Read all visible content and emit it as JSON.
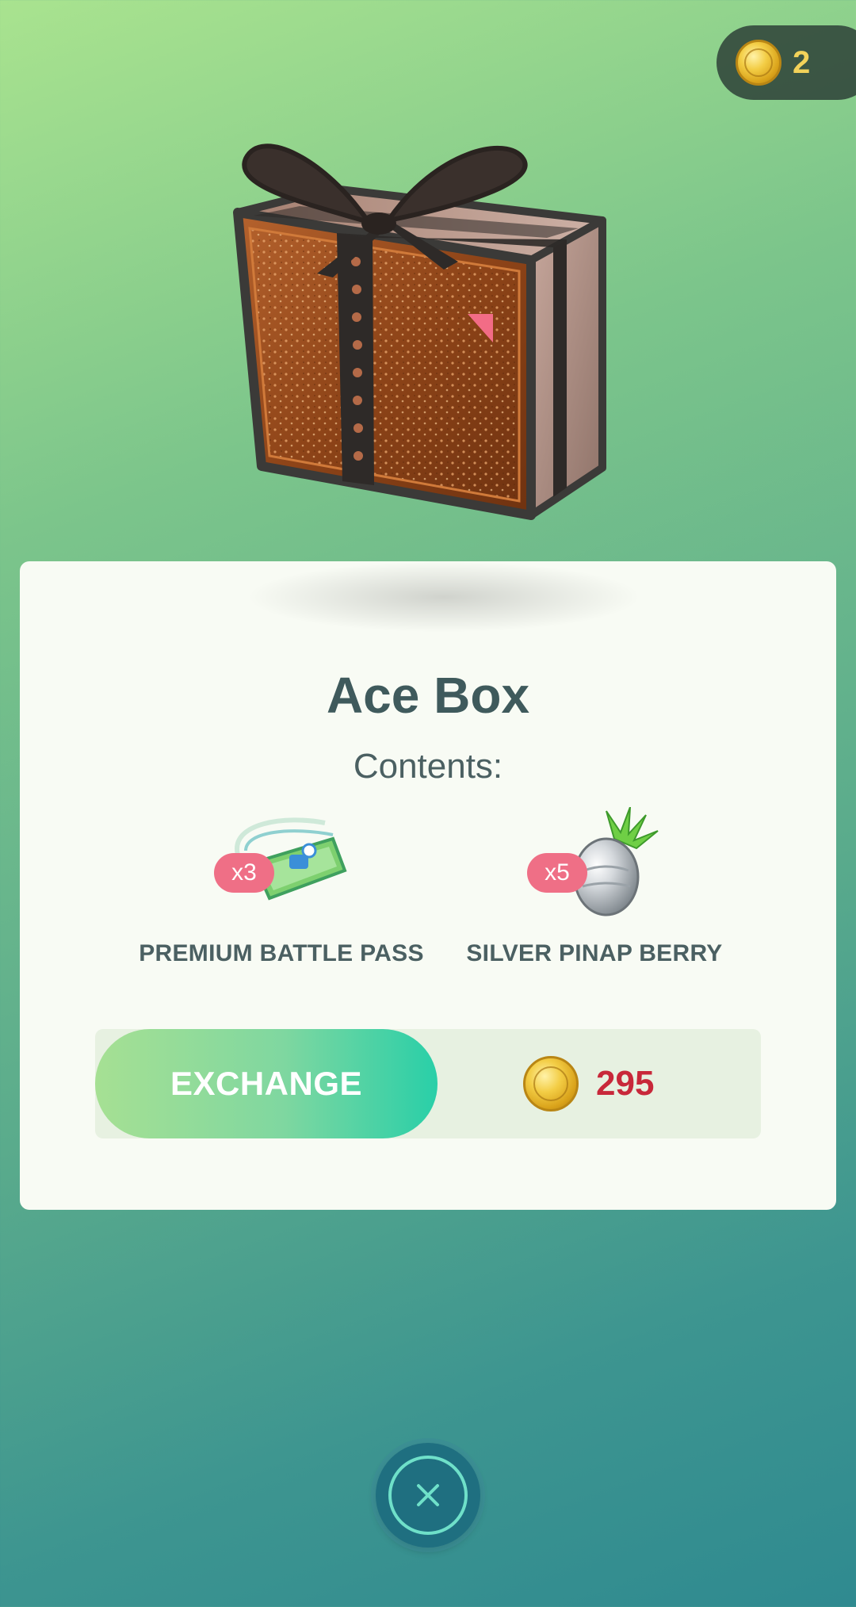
{
  "header": {
    "coin_count": "2"
  },
  "box": {
    "title": "Ace Box",
    "contents_label": "Contents:"
  },
  "items": [
    {
      "quantity": "x3",
      "name": "PREMIUM BATTLE PASS",
      "icon": "premium-battle-pass-icon"
    },
    {
      "quantity": "x5",
      "name": "SILVER PINAP BERRY",
      "icon": "silver-pinap-berry-icon"
    }
  ],
  "exchange": {
    "button_label": "EXCHANGE",
    "price": "295"
  },
  "colors": {
    "price_red": "#c8283a",
    "coin_gold": "#f3cd45",
    "quantity_pink": "#ef6f86",
    "button_gradient_end": "#29cfa8"
  },
  "icons": {
    "coin": "pokecoin-icon",
    "close": "close-icon"
  }
}
